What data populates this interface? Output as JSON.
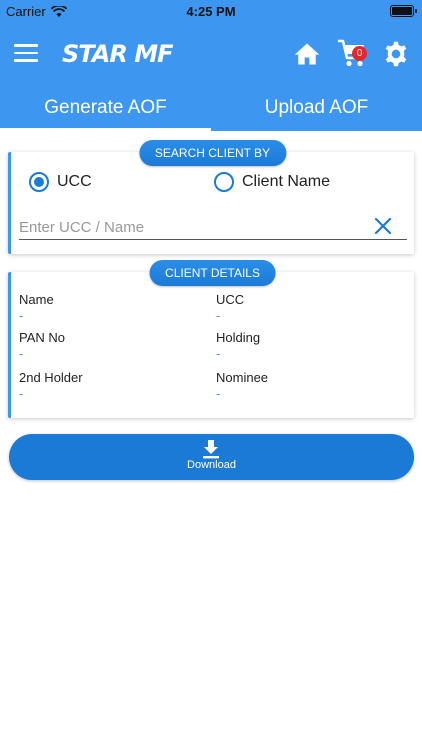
{
  "status_bar": {
    "carrier": "Carrier",
    "time": "4:25 PM"
  },
  "header": {
    "logo": "STAR MF",
    "cart_count": "0",
    "icons": [
      "menu-icon",
      "home-icon",
      "cart-icon",
      "gear-icon"
    ]
  },
  "tabs": [
    {
      "label": "Generate AOF",
      "active": true
    },
    {
      "label": "Upload AOF",
      "active": false
    }
  ],
  "search": {
    "title": "SEARCH CLIENT BY",
    "options": [
      {
        "label": "UCC",
        "selected": true
      },
      {
        "label": "Client Name",
        "selected": false
      }
    ],
    "placeholder": "Enter UCC / Name",
    "value": ""
  },
  "details": {
    "title": "CLIENT DETAILS",
    "fields": [
      {
        "label": "Name",
        "value": "-"
      },
      {
        "label": "UCC",
        "value": "-"
      },
      {
        "label": "PAN No",
        "value": "-"
      },
      {
        "label": "Holding",
        "value": "-"
      },
      {
        "label": "2nd Holder",
        "value": "-"
      },
      {
        "label": "Nominee",
        "value": "-"
      }
    ]
  },
  "download": {
    "label": "Download"
  },
  "colors": {
    "primary": "#3d97f0",
    "accent": "#1b7ad6",
    "badge": "#e4262b"
  }
}
